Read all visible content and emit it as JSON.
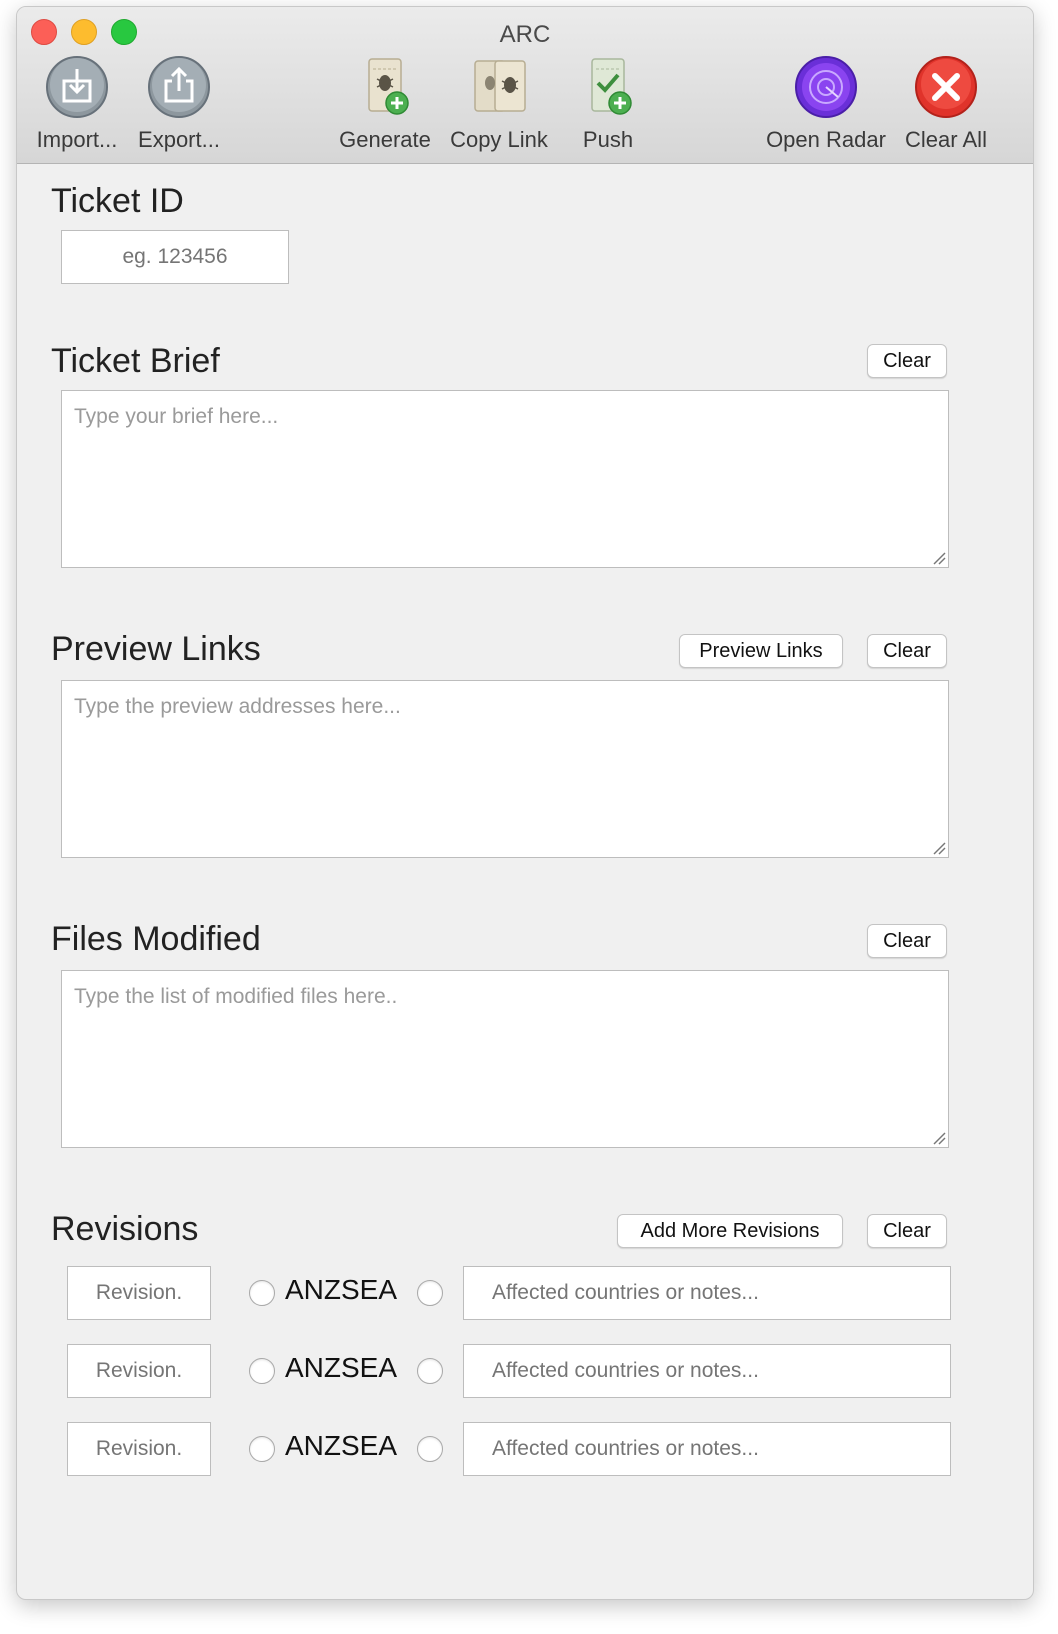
{
  "window": {
    "title": "ARC"
  },
  "toolbar": {
    "import": "Import...",
    "export": "Export...",
    "generate": "Generate",
    "copy_link": "Copy Link",
    "push": "Push",
    "open_radar": "Open Radar",
    "clear_all": "Clear All"
  },
  "ticket_id": {
    "title": "Ticket ID",
    "placeholder": "eg. 123456"
  },
  "ticket_brief": {
    "title": "Ticket Brief",
    "clear": "Clear",
    "placeholder": "Type your brief here..."
  },
  "preview_links": {
    "title": "Preview Links",
    "preview_button": "Preview Links",
    "clear": "Clear",
    "placeholder": "Type the preview addresses here..."
  },
  "files_modified": {
    "title": "Files Modified",
    "clear": "Clear",
    "placeholder": "Type the list of modified files here.."
  },
  "revisions": {
    "title": "Revisions",
    "add_more": "Add More Revisions",
    "clear": "Clear",
    "rows": [
      {
        "revision_placeholder": "Revision.",
        "region": "ANZSEA",
        "notes_placeholder": "Affected countries or notes..."
      },
      {
        "revision_placeholder": "Revision.",
        "region": "ANZSEA",
        "notes_placeholder": "Affected countries or notes..."
      },
      {
        "revision_placeholder": "Revision.",
        "region": "ANZSEA",
        "notes_placeholder": "Affected countries or notes..."
      }
    ]
  },
  "icons": [
    "import-icon",
    "export-icon",
    "generate-icon",
    "copy-link-icon",
    "push-icon",
    "open-radar-icon",
    "clear-all-icon"
  ]
}
